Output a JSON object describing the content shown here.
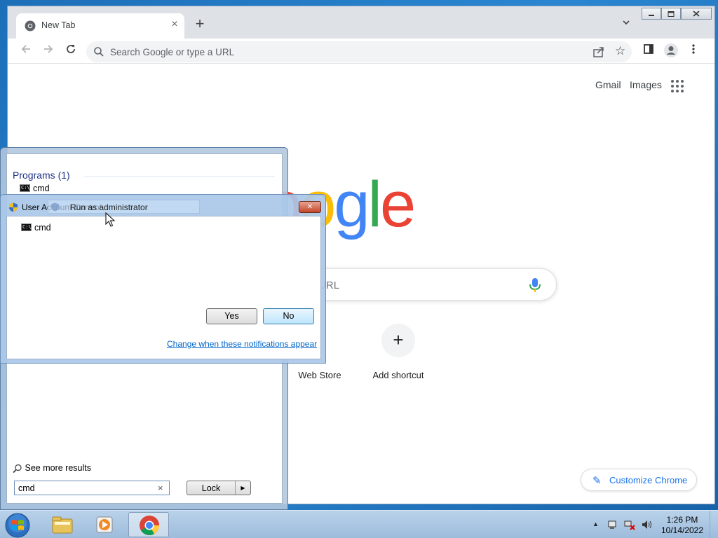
{
  "browser": {
    "tab_title": "New Tab",
    "tab_close": "×",
    "new_tab": "+",
    "omnibox_placeholder": "Search Google or type a URL",
    "window_buttons": [
      "minimize-icon",
      "maximize-icon",
      "close-icon"
    ]
  },
  "google": {
    "gmail": "Gmail",
    "images": "Images",
    "logo_letters": [
      "o",
      "o",
      "g",
      "l",
      "e"
    ],
    "search_placeholder": "type a URL",
    "shortcuts": [
      {
        "label": "Web Store",
        "icon": "webstore-icon"
      },
      {
        "label": "Add shortcut",
        "icon": "plus-icon",
        "glyph": "+"
      }
    ],
    "customize": "Customize Chrome",
    "colors": {
      "blue": "#4285F4",
      "red": "#EA4335",
      "yellow": "#FBBC05",
      "green": "#34A853",
      "link": "#1a73e8"
    }
  },
  "start_menu": {
    "programs_header": "Programs (1)",
    "program_item": "cmd",
    "see_more": "See more results",
    "search_value": "cmd",
    "clear": "×",
    "lock_label": "Lock",
    "lock_arrow": "▶"
  },
  "uac": {
    "title": "User Account Control",
    "program": "cmd",
    "yes": "Yes",
    "no": "No",
    "link": "Change when these notifications appear",
    "close": "✕"
  },
  "context_item": {
    "label": "Run as administrator"
  },
  "taskbar": {
    "apps": [
      "explorer-icon",
      "media-player-icon",
      "chrome-icon"
    ],
    "tray_arrow": "▲",
    "time": "1:26 PM",
    "date": "10/14/2022"
  }
}
